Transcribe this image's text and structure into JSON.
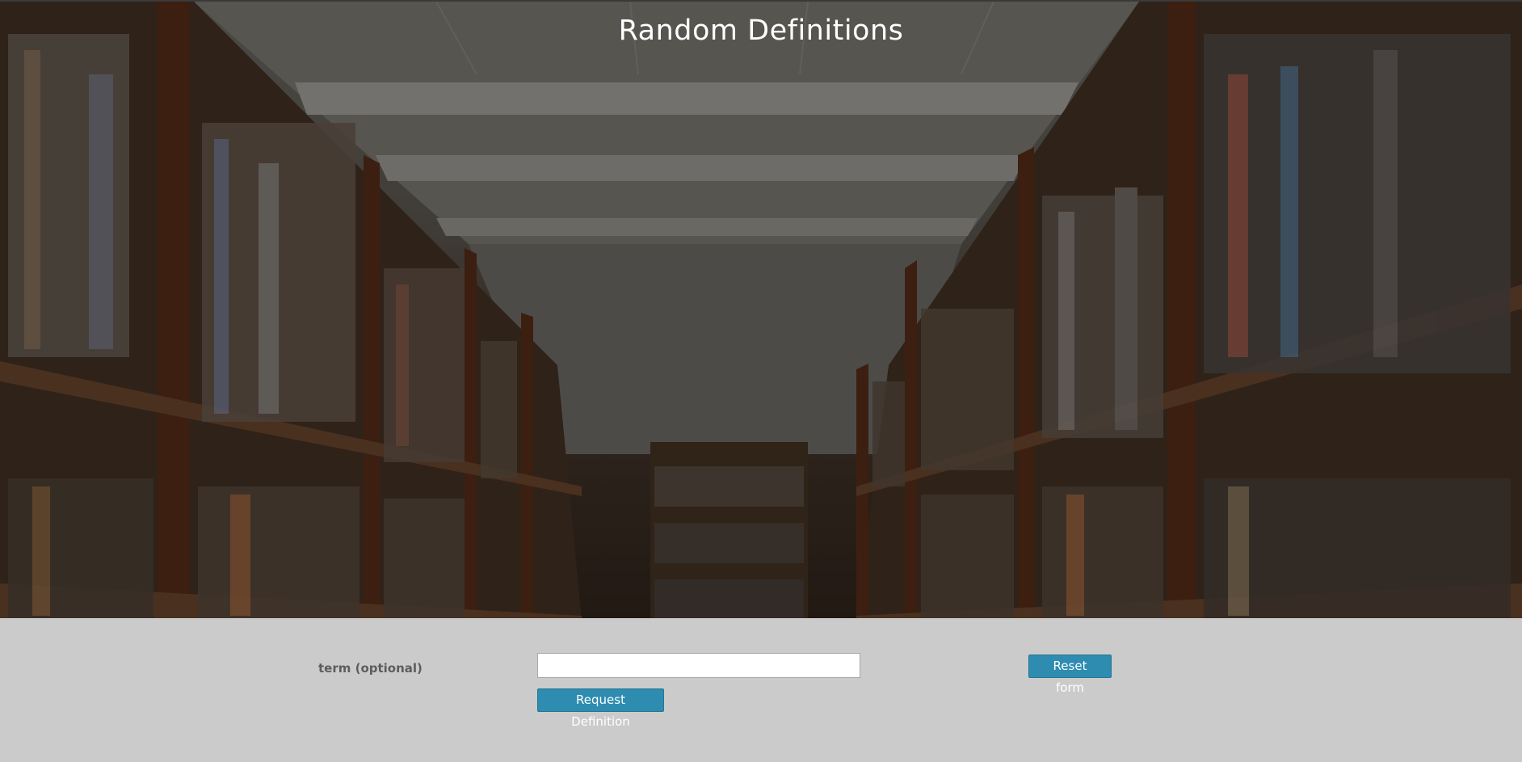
{
  "header": {
    "title": "Random Definitions"
  },
  "form": {
    "term_label": "term (optional)",
    "term_value": "",
    "term_placeholder": "",
    "request_button_label": "Request Definition",
    "reset_button_label": "Reset form"
  },
  "colors": {
    "button_bg": "#2e8cb0",
    "form_bg": "#cbcbcb",
    "label_text": "#5d5d5d"
  },
  "icons": {
    "hero_image": "library-bookshelves-image"
  }
}
